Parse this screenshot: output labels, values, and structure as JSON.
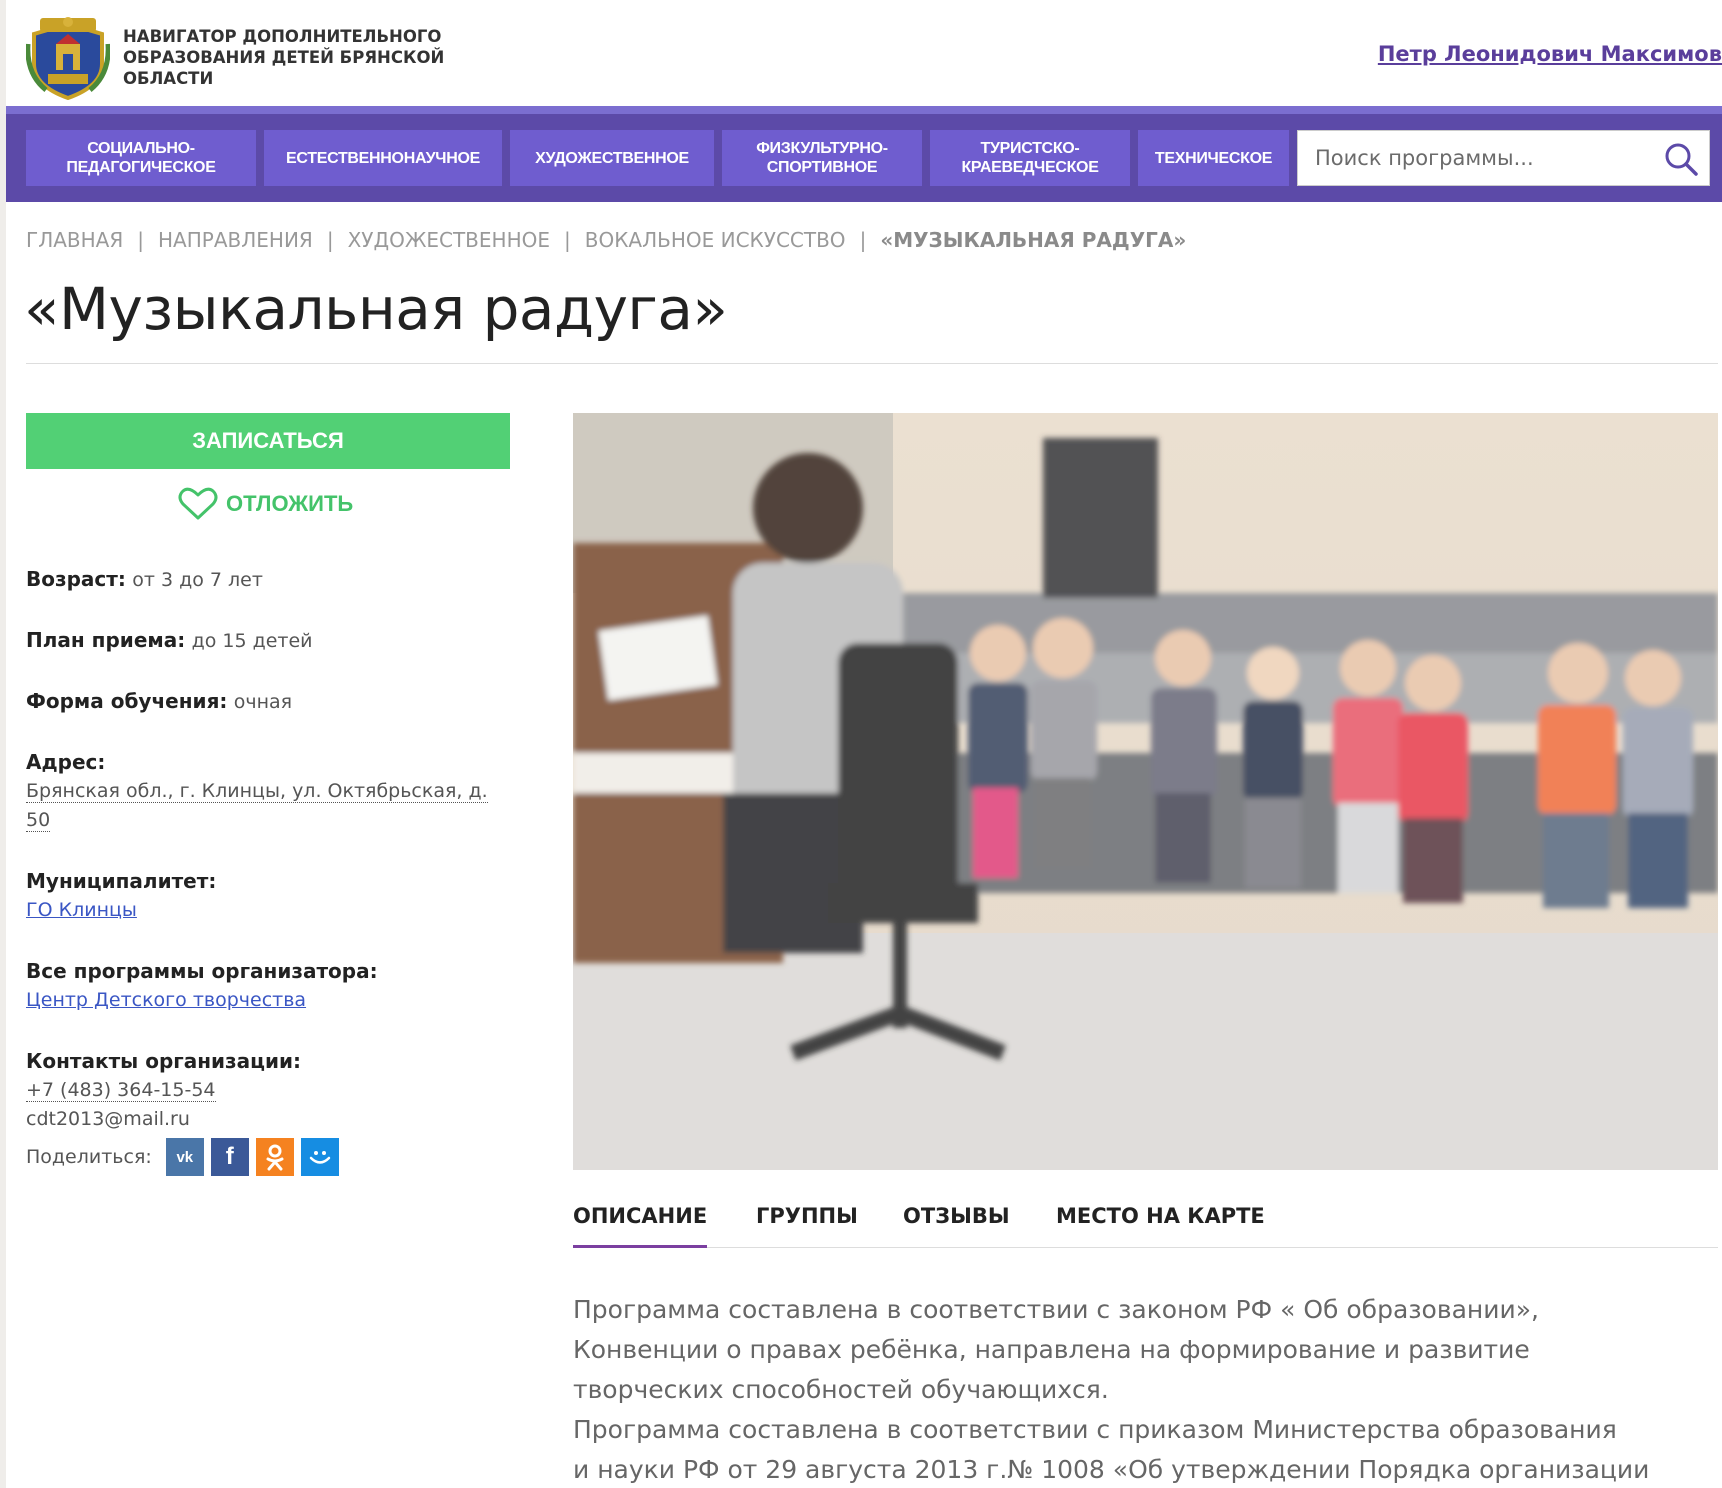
{
  "header": {
    "site_title": "Навигатор дополнительного образования детей Брянской области",
    "user_name": "Петр Леонидович Максимов"
  },
  "nav": {
    "items": [
      {
        "label": "Социально-педагогическое"
      },
      {
        "label": "Естественнонаучное"
      },
      {
        "label": "Художественное"
      },
      {
        "label": "Физкультурно-спортивное"
      },
      {
        "label": "Туристско-краеведческое"
      },
      {
        "label": "Техническое"
      }
    ],
    "search_placeholder": "Поиск программы..."
  },
  "breadcrumb": {
    "items": [
      "Главная",
      "Направления",
      "Художественное",
      "Вокальное искусство"
    ],
    "current": "«Музыкальная радуга»",
    "separator": "|"
  },
  "program": {
    "title": "«Музыкальная радуга»",
    "enroll_label": "Записаться",
    "postpone_label": "Отложить",
    "age_label": "Возраст:",
    "age_value": "от 3 до 7 лет",
    "plan_label": "План приема:",
    "plan_value": "до 15 детей",
    "form_label": "Форма обучения:",
    "form_value": "очная",
    "address_label": "Адрес:",
    "address_line1": "Брянская обл., г. Клинцы, ул. Октябрьская, д.",
    "address_line2": "50",
    "municipality_label": "Муниципалитет:",
    "municipality_value": "ГО Клинцы",
    "organizer_label": "Все программы организатора:",
    "organizer_value": "Центр Детского творчества",
    "contacts_label": "Контакты организации:",
    "phone": "+7 (483) 364-15-54",
    "email": "cdt2013@mail.ru",
    "share_label": "Поделиться:"
  },
  "share_buttons": [
    {
      "name": "vk-icon",
      "color": "#4a76a8",
      "glyph": "vk"
    },
    {
      "name": "facebook-icon",
      "color": "#3b5998",
      "glyph": "f"
    },
    {
      "name": "odnoklassniki-icon",
      "color": "#f58220",
      "glyph": "ok"
    },
    {
      "name": "mailru-icon",
      "color": "#168de2",
      "glyph": "@"
    }
  ],
  "tabs": [
    {
      "label": "Описание",
      "active": true
    },
    {
      "label": "Группы",
      "active": false
    },
    {
      "label": "Отзывы",
      "active": false
    },
    {
      "label": "Место на карте",
      "active": false
    }
  ],
  "description": {
    "lines": [
      "Программа составлена в соответствии с законом РФ « Об образовании»,",
      "Конвенции о правах ребёнка, направлена на формирование и развитие",
      "творческих способностей обучающихся.",
      "Программа составлена в соответствии с приказом Министерства образования",
      "и науки РФ от 29 августа 2013 г.№ 1008 «Об утверждении Порядка организации"
    ]
  },
  "colors": {
    "nav_bg": "#5c4aa8",
    "nav_item": "#6f5dcf",
    "enroll": "#52d075",
    "link": "#3a56c4",
    "user_link": "#5a3e9b",
    "tab_active": "#7b3fa0"
  }
}
